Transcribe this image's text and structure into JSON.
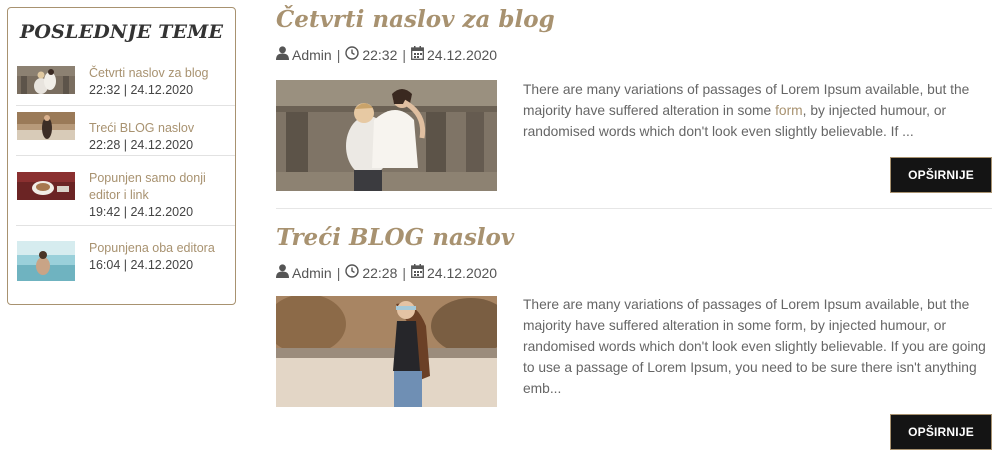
{
  "sidebar": {
    "title": "POSLEDNJE TEME",
    "items": [
      {
        "title": "Četvrti naslov za blog",
        "meta": "22:32 | 24.12.2020",
        "thumb": "wedding-couple-thumb"
      },
      {
        "title": "Treći BLOG naslov",
        "meta": "22:28 | 24.12.2020",
        "thumb": "girl-on-beach-thumb"
      },
      {
        "title": "Popunjen samo donji editor i link",
        "meta": "19:42 | 24.12.2020",
        "thumb": "coffee-cup-thumb"
      },
      {
        "title": "Popunjena oba editora",
        "meta": "16:04 | 24.12.2020",
        "thumb": "sea-woman-thumb"
      }
    ]
  },
  "posts": [
    {
      "title": "Četvrti naslov za blog",
      "author": "Admin",
      "time": "22:32",
      "date": "24.12.2020",
      "excerpt_before": "There are many variations of passages of Lorem Ipsum available, but the majority have suffered alteration in some ",
      "excerpt_link": "form",
      "excerpt_after": ", by injected humour, or randomised words which don't look even slightly believable. If ...",
      "read_more": "OPŠIRNIJE",
      "image": "wedding-couple-photo"
    },
    {
      "title": "Treći BLOG naslov",
      "author": "Admin",
      "time": "22:28",
      "date": "24.12.2020",
      "excerpt": "There are many variations of passages of Lorem Ipsum available, but the majority have suffered alteration in some form, by injected humour, or randomised words which don't look even slightly believable. If you are going to use a passage of Lorem Ipsum, you need to be sure there isn't anything emb...",
      "read_more": "OPŠIRNIJE",
      "image": "girl-on-beach-photo"
    }
  ],
  "colors": {
    "accent": "#a89270",
    "button_bg": "#141414"
  }
}
